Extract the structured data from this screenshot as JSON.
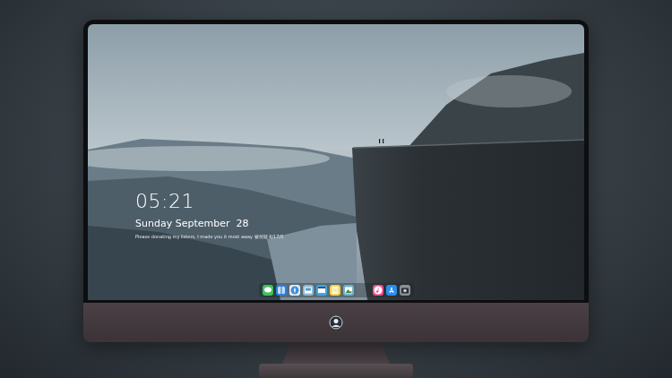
{
  "lock_screen": {
    "time": "05:21",
    "date": "Sunday September  28",
    "caption": "Please donating my listers, I made you it most away 被何疑 8/17/5"
  },
  "dock": {
    "left": [
      {
        "kind": "messages",
        "color": "#3fc35a"
      },
      {
        "kind": "finder",
        "color": "#2f7fe0"
      },
      {
        "kind": "safari",
        "color": "#e8eef3"
      },
      {
        "kind": "preview",
        "color": "#8fb9d6"
      },
      {
        "kind": "video",
        "color": "#3aa8e8"
      },
      {
        "kind": "notes",
        "color": "#f5d34a"
      },
      {
        "kind": "photos",
        "color": "#6fb2c8"
      }
    ],
    "right": [
      {
        "kind": "music",
        "color": "#f0508a"
      },
      {
        "kind": "appstore",
        "color": "#2b8df0"
      },
      {
        "kind": "camera",
        "color": "#8a9096"
      }
    ]
  }
}
